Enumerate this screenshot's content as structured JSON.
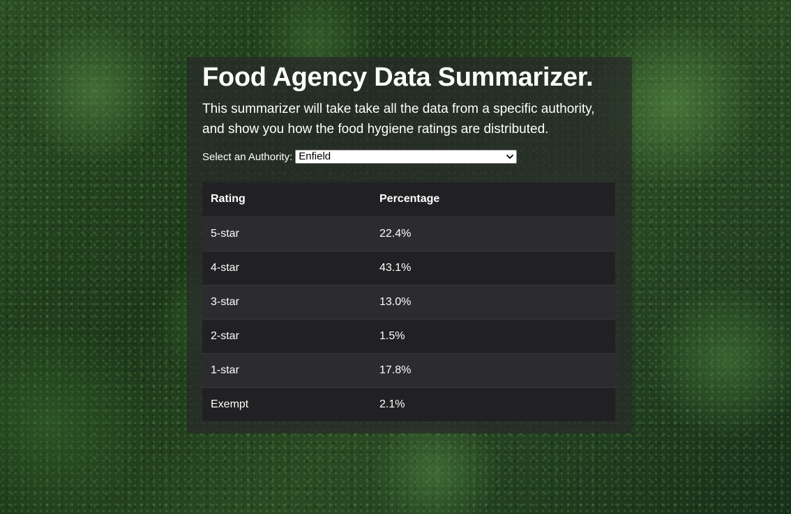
{
  "page": {
    "title": "Food Agency Data Summarizer.",
    "intro_line1": "This summarizer will take take all the data from a specific authority,",
    "intro_line2": "and show you how the food hygiene ratings are distributed."
  },
  "authority_select": {
    "label": "Select an Authority:",
    "selected": "Enfield",
    "icon": "chevron-down-icon"
  },
  "ratings_table": {
    "headers": [
      "Rating",
      "Percentage"
    ],
    "rows": [
      {
        "rating": "5-star",
        "percentage": "22.4%"
      },
      {
        "rating": "4-star",
        "percentage": "43.1%"
      },
      {
        "rating": "3-star",
        "percentage": "13.0%"
      },
      {
        "rating": "2-star",
        "percentage": "1.5%"
      },
      {
        "rating": "1-star",
        "percentage": "17.8%"
      },
      {
        "rating": "Exempt",
        "percentage": "2.1%"
      }
    ]
  },
  "colors": {
    "panel_bg": "#28282a",
    "table_row_dark": "#212124",
    "table_row_light": "#2c2c30",
    "text": "#ffffff"
  }
}
